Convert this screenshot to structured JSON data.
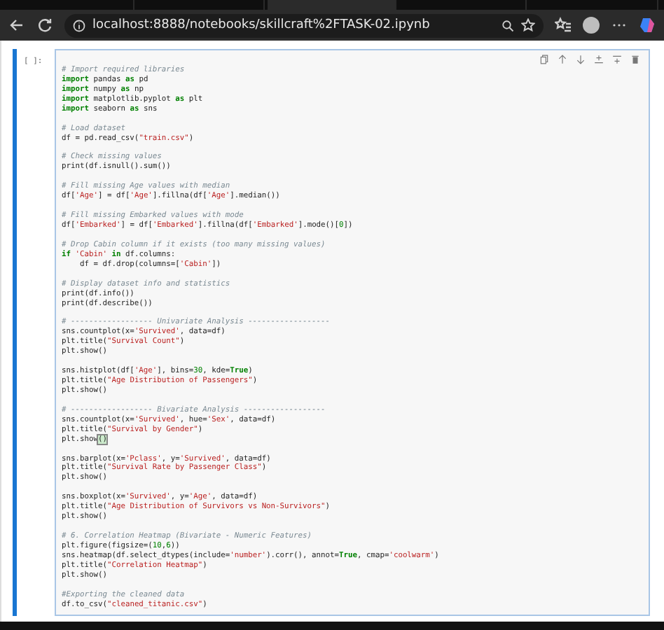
{
  "browser": {
    "url": "localhost:8888/notebooks/skillcraft%2FTASK-02.ipynb"
  },
  "cell": {
    "prompt": "[ ]:",
    "lines": [
      {
        "kind": "code",
        "segments": [
          {
            "kind": "comment",
            "text": "# Import required libraries"
          }
        ]
      },
      {
        "kind": "code",
        "segments": [
          {
            "kind": "keyword",
            "text": "import"
          },
          {
            "kind": "plain",
            "text": " pandas "
          },
          {
            "kind": "keyword",
            "text": "as"
          },
          {
            "kind": "plain",
            "text": " pd"
          }
        ]
      },
      {
        "kind": "code",
        "segments": [
          {
            "kind": "keyword",
            "text": "import"
          },
          {
            "kind": "plain",
            "text": " numpy "
          },
          {
            "kind": "keyword",
            "text": "as"
          },
          {
            "kind": "plain",
            "text": " np"
          }
        ]
      },
      {
        "kind": "code",
        "segments": [
          {
            "kind": "keyword",
            "text": "import"
          },
          {
            "kind": "plain",
            "text": " matplotlib.pyplot "
          },
          {
            "kind": "keyword",
            "text": "as"
          },
          {
            "kind": "plain",
            "text": " plt"
          }
        ]
      },
      {
        "kind": "code",
        "segments": [
          {
            "kind": "keyword",
            "text": "import"
          },
          {
            "kind": "plain",
            "text": " seaborn "
          },
          {
            "kind": "keyword",
            "text": "as"
          },
          {
            "kind": "plain",
            "text": " sns"
          }
        ]
      },
      {
        "kind": "blank"
      },
      {
        "kind": "code",
        "segments": [
          {
            "kind": "comment",
            "text": "# Load dataset"
          }
        ]
      },
      {
        "kind": "code",
        "segments": [
          {
            "kind": "plain",
            "text": "df = pd.read_csv("
          },
          {
            "kind": "string",
            "text": "\"train.csv\""
          },
          {
            "kind": "plain",
            "text": ")"
          }
        ]
      },
      {
        "kind": "blank"
      },
      {
        "kind": "code",
        "segments": [
          {
            "kind": "comment",
            "text": "# Check missing values"
          }
        ]
      },
      {
        "kind": "code",
        "segments": [
          {
            "kind": "plain",
            "text": "print(df.isnull().sum())"
          }
        ]
      },
      {
        "kind": "blank"
      },
      {
        "kind": "code",
        "segments": [
          {
            "kind": "comment",
            "text": "# Fill missing Age values with median"
          }
        ]
      },
      {
        "kind": "code",
        "segments": [
          {
            "kind": "plain",
            "text": "df["
          },
          {
            "kind": "string",
            "text": "'Age'"
          },
          {
            "kind": "plain",
            "text": "] = df["
          },
          {
            "kind": "string",
            "text": "'Age'"
          },
          {
            "kind": "plain",
            "text": "].fillna(df["
          },
          {
            "kind": "string",
            "text": "'Age'"
          },
          {
            "kind": "plain",
            "text": "].median())"
          }
        ]
      },
      {
        "kind": "blank"
      },
      {
        "kind": "code",
        "segments": [
          {
            "kind": "comment",
            "text": "# Fill missing Embarked values with mode"
          }
        ]
      },
      {
        "kind": "code",
        "segments": [
          {
            "kind": "plain",
            "text": "df["
          },
          {
            "kind": "string",
            "text": "'Embarked'"
          },
          {
            "kind": "plain",
            "text": "] = df["
          },
          {
            "kind": "string",
            "text": "'Embarked'"
          },
          {
            "kind": "plain",
            "text": "].fillna(df["
          },
          {
            "kind": "string",
            "text": "'Embarked'"
          },
          {
            "kind": "plain",
            "text": "].mode()["
          },
          {
            "kind": "number",
            "text": "0"
          },
          {
            "kind": "plain",
            "text": "])"
          }
        ]
      },
      {
        "kind": "blank"
      },
      {
        "kind": "code",
        "segments": [
          {
            "kind": "comment",
            "text": "# Drop Cabin column if it exists (too many missing values)"
          }
        ]
      },
      {
        "kind": "code",
        "segments": [
          {
            "kind": "keyword",
            "text": "if"
          },
          {
            "kind": "string",
            "text": " 'Cabin' "
          },
          {
            "kind": "keyword",
            "text": "in"
          },
          {
            "kind": "plain",
            "text": " df.columns:"
          }
        ]
      },
      {
        "kind": "code",
        "segments": [
          {
            "kind": "plain",
            "text": "    df = df.drop(columns=["
          },
          {
            "kind": "string",
            "text": "'Cabin'"
          },
          {
            "kind": "plain",
            "text": "])"
          }
        ]
      },
      {
        "kind": "blank"
      },
      {
        "kind": "code",
        "segments": [
          {
            "kind": "comment",
            "text": "# Display dataset info and statistics"
          }
        ]
      },
      {
        "kind": "code",
        "segments": [
          {
            "kind": "plain",
            "text": "print(df.info())"
          }
        ]
      },
      {
        "kind": "code",
        "segments": [
          {
            "kind": "plain",
            "text": "print(df.describe())"
          }
        ]
      },
      {
        "kind": "blank"
      },
      {
        "kind": "code",
        "segments": [
          {
            "kind": "comment",
            "text": "# ------------------ Univariate Analysis ------------------"
          }
        ]
      },
      {
        "kind": "code",
        "segments": [
          {
            "kind": "plain",
            "text": "sns.countplot(x="
          },
          {
            "kind": "string",
            "text": "'Survived'"
          },
          {
            "kind": "plain",
            "text": ", data=df)"
          }
        ]
      },
      {
        "kind": "code",
        "segments": [
          {
            "kind": "plain",
            "text": "plt.title("
          },
          {
            "kind": "string",
            "text": "\"Survival Count\""
          },
          {
            "kind": "plain",
            "text": ")"
          }
        ]
      },
      {
        "kind": "code",
        "segments": [
          {
            "kind": "plain",
            "text": "plt.show()"
          }
        ]
      },
      {
        "kind": "blank"
      },
      {
        "kind": "code",
        "segments": [
          {
            "kind": "plain",
            "text": "sns.histplot(df["
          },
          {
            "kind": "string",
            "text": "'Age'"
          },
          {
            "kind": "plain",
            "text": "], bins="
          },
          {
            "kind": "number",
            "text": "30"
          },
          {
            "kind": "plain",
            "text": ", kde="
          },
          {
            "kind": "keyword",
            "text": "True"
          },
          {
            "kind": "plain",
            "text": ")"
          }
        ]
      },
      {
        "kind": "code",
        "segments": [
          {
            "kind": "plain",
            "text": "plt.title("
          },
          {
            "kind": "string",
            "text": "\"Age Distribution of Passengers\""
          },
          {
            "kind": "plain",
            "text": ")"
          }
        ]
      },
      {
        "kind": "code",
        "segments": [
          {
            "kind": "plain",
            "text": "plt.show()"
          }
        ]
      },
      {
        "kind": "blank"
      },
      {
        "kind": "code",
        "segments": [
          {
            "kind": "comment",
            "text": "# ------------------ Bivariate Analysis ------------------"
          }
        ]
      },
      {
        "kind": "code",
        "segments": [
          {
            "kind": "plain",
            "text": "sns.countplot(x="
          },
          {
            "kind": "string",
            "text": "'Survived'"
          },
          {
            "kind": "plain",
            "text": ", hue="
          },
          {
            "kind": "string",
            "text": "'Sex'"
          },
          {
            "kind": "plain",
            "text": ", data=df)"
          }
        ]
      },
      {
        "kind": "code",
        "segments": [
          {
            "kind": "plain",
            "text": "plt.title("
          },
          {
            "kind": "string",
            "text": "\"Survival by Gender\""
          },
          {
            "kind": "plain",
            "text": ")"
          }
        ]
      },
      {
        "kind": "code",
        "segments": [
          {
            "kind": "plain",
            "text": "plt.show"
          },
          {
            "kind": "match",
            "text": "()"
          }
        ]
      },
      {
        "kind": "blank"
      },
      {
        "kind": "code",
        "segments": [
          {
            "kind": "plain",
            "text": "sns.barplot(x="
          },
          {
            "kind": "string",
            "text": "'Pclass'"
          },
          {
            "kind": "plain",
            "text": ", y="
          },
          {
            "kind": "string",
            "text": "'Survived'"
          },
          {
            "kind": "plain",
            "text": ", data=df)"
          }
        ]
      },
      {
        "kind": "code",
        "segments": [
          {
            "kind": "plain",
            "text": "plt.title("
          },
          {
            "kind": "string",
            "text": "\"Survival Rate by Passenger Class\""
          },
          {
            "kind": "plain",
            "text": ")"
          }
        ]
      },
      {
        "kind": "code",
        "segments": [
          {
            "kind": "plain",
            "text": "plt.show()"
          }
        ]
      },
      {
        "kind": "blank"
      },
      {
        "kind": "code",
        "segments": [
          {
            "kind": "plain",
            "text": "sns.boxplot(x="
          },
          {
            "kind": "string",
            "text": "'Survived'"
          },
          {
            "kind": "plain",
            "text": ", y="
          },
          {
            "kind": "string",
            "text": "'Age'"
          },
          {
            "kind": "plain",
            "text": ", data=df)"
          }
        ]
      },
      {
        "kind": "code",
        "segments": [
          {
            "kind": "plain",
            "text": "plt.title("
          },
          {
            "kind": "string",
            "text": "\"Age Distribution of Survivors vs Non-Survivors\""
          },
          {
            "kind": "plain",
            "text": ")"
          }
        ]
      },
      {
        "kind": "code",
        "segments": [
          {
            "kind": "plain",
            "text": "plt.show()"
          }
        ]
      },
      {
        "kind": "blank"
      },
      {
        "kind": "code",
        "segments": [
          {
            "kind": "comment",
            "text": "# 6. Correlation Heatmap (Bivariate - Numeric Features)"
          }
        ]
      },
      {
        "kind": "code",
        "segments": [
          {
            "kind": "plain",
            "text": "plt.figure(figsize=("
          },
          {
            "kind": "number",
            "text": "10"
          },
          {
            "kind": "plain",
            "text": ","
          },
          {
            "kind": "number",
            "text": "6"
          },
          {
            "kind": "plain",
            "text": "))"
          }
        ]
      },
      {
        "kind": "code",
        "segments": [
          {
            "kind": "plain",
            "text": "sns.heatmap(df.select_dtypes(include="
          },
          {
            "kind": "string",
            "text": "'number'"
          },
          {
            "kind": "plain",
            "text": ").corr(), annot="
          },
          {
            "kind": "keyword",
            "text": "True"
          },
          {
            "kind": "plain",
            "text": ", cmap="
          },
          {
            "kind": "string",
            "text": "'coolwarm'"
          },
          {
            "kind": "plain",
            "text": ")"
          }
        ]
      },
      {
        "kind": "code",
        "segments": [
          {
            "kind": "plain",
            "text": "plt.title("
          },
          {
            "kind": "string",
            "text": "\"Correlation Heatmap\""
          },
          {
            "kind": "plain",
            "text": ")"
          }
        ]
      },
      {
        "kind": "code",
        "segments": [
          {
            "kind": "plain",
            "text": "plt.show()"
          }
        ]
      },
      {
        "kind": "blank"
      },
      {
        "kind": "code",
        "segments": [
          {
            "kind": "comment",
            "text": "#Exporting the cleaned data"
          }
        ]
      },
      {
        "kind": "code",
        "segments": [
          {
            "kind": "plain",
            "text": "df.to_csv("
          },
          {
            "kind": "string",
            "text": "\"cleaned_titanic.csv\""
          },
          {
            "kind": "plain",
            "text": ")"
          }
        ]
      }
    ]
  }
}
